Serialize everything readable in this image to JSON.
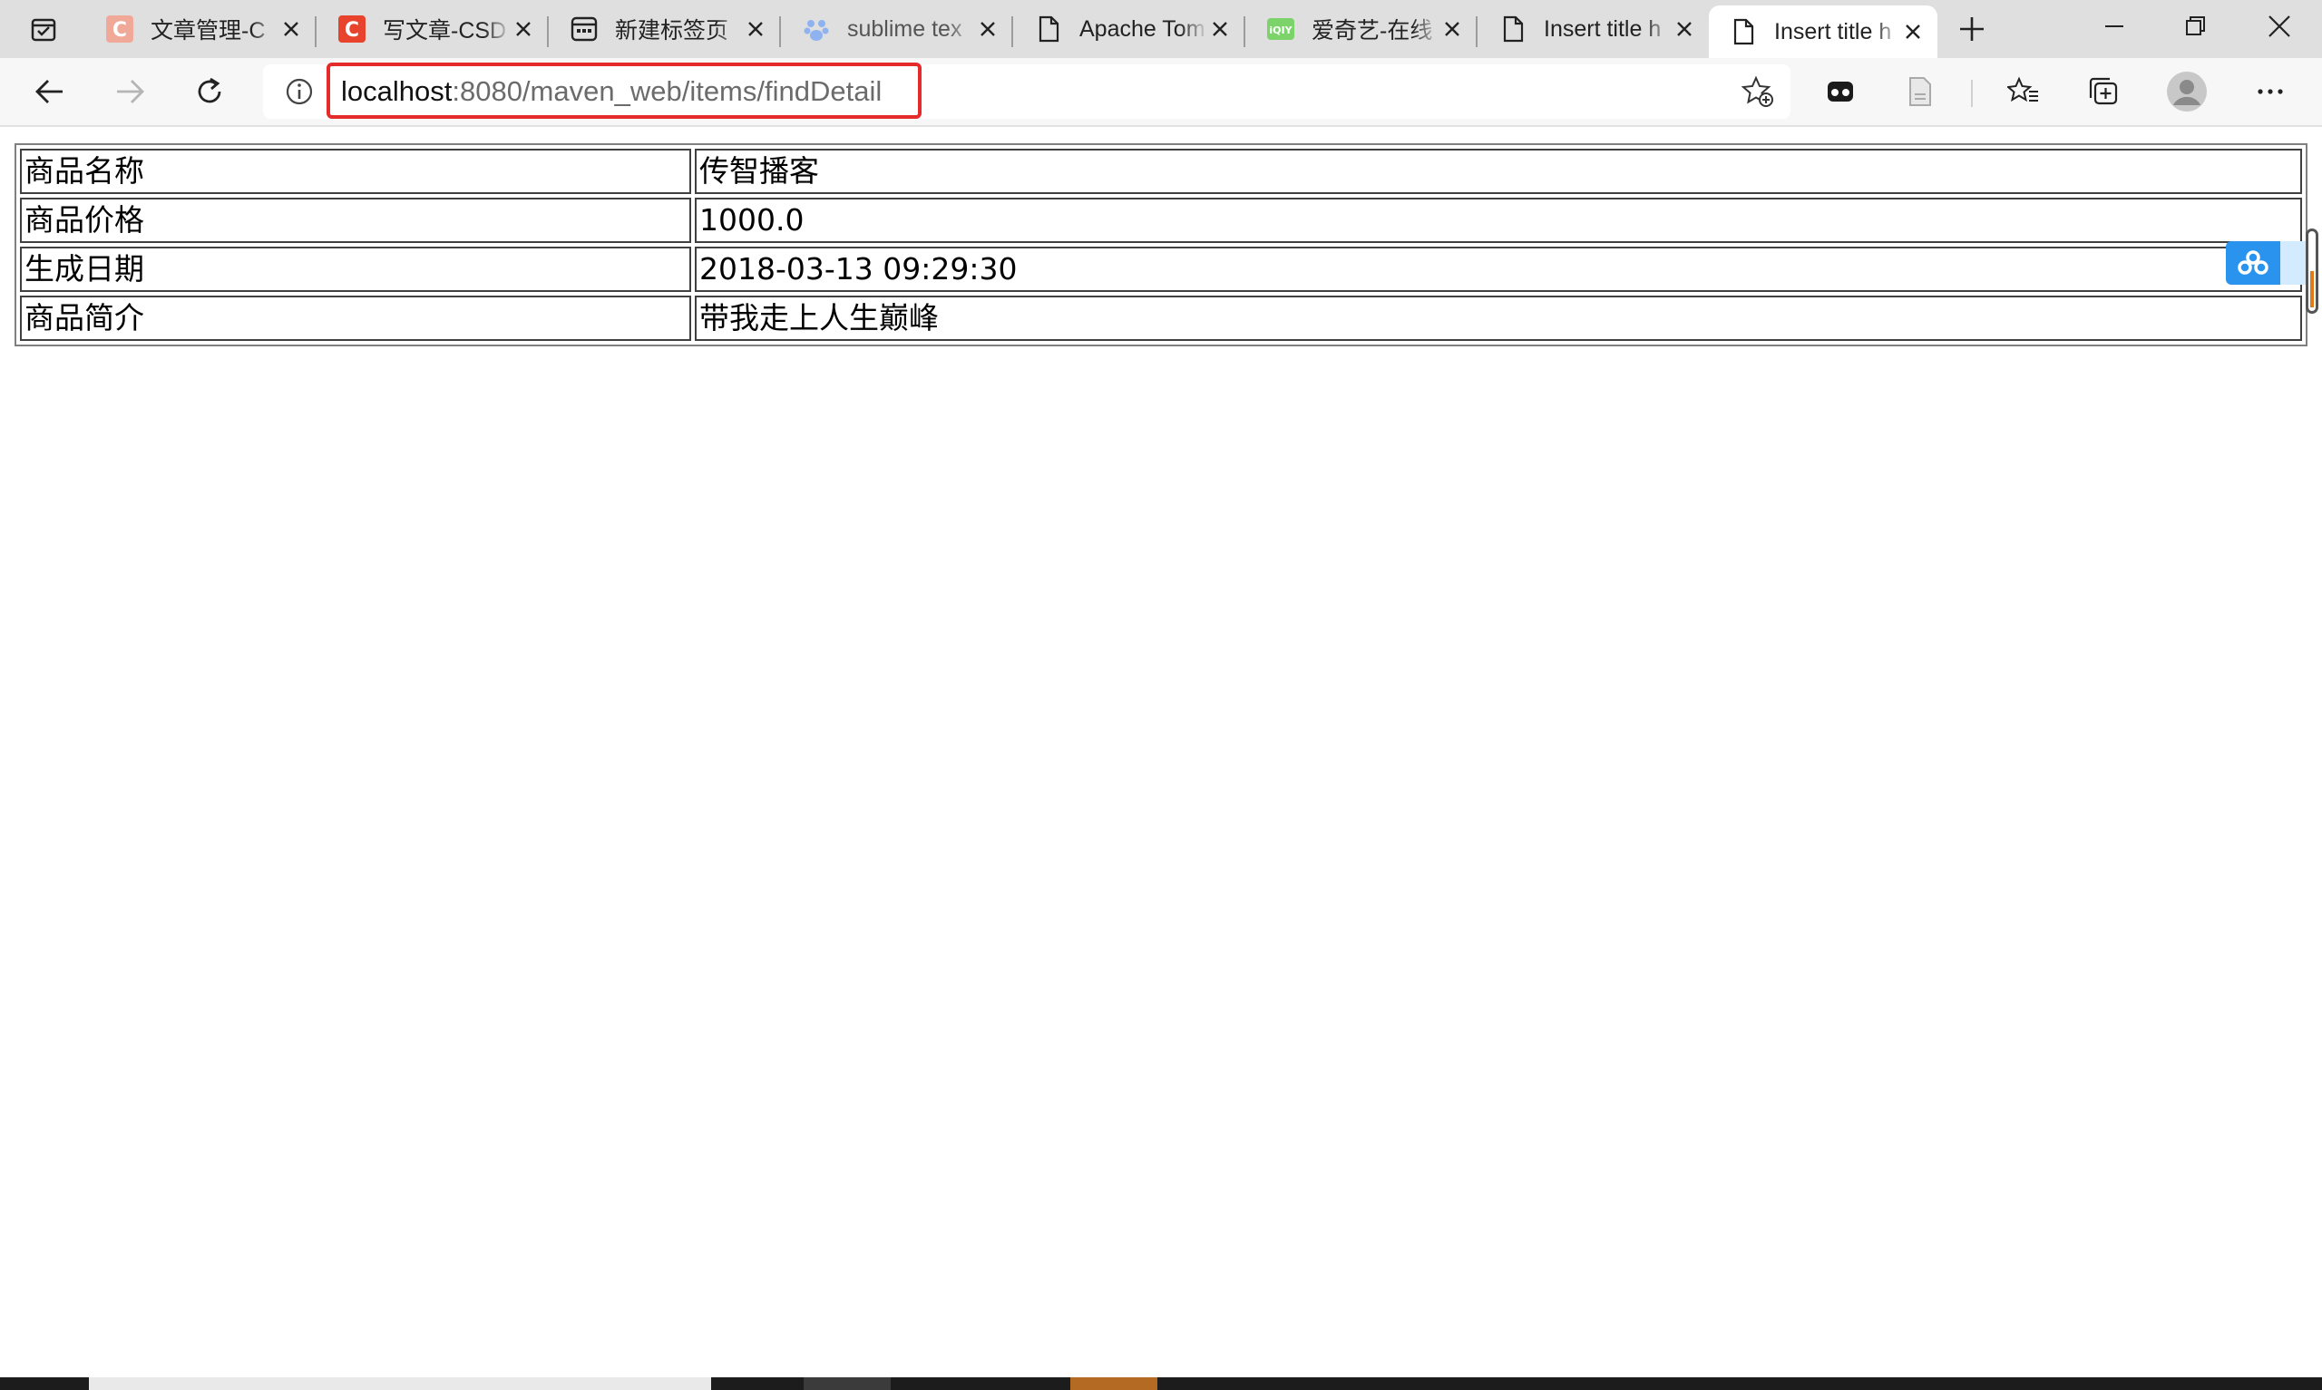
{
  "browser": {
    "tabs": [
      {
        "title": "文章管理-C",
        "favicon": "csdn-faded-icon",
        "active": false
      },
      {
        "title": "写文章-CSD",
        "favicon": "csdn-icon",
        "active": false
      },
      {
        "title": "新建标签页",
        "favicon": "newtab-page-icon",
        "active": false
      },
      {
        "title": "sublime tex",
        "favicon": "baidu-paw-icon",
        "active": false
      },
      {
        "title": "Apache Tom",
        "favicon": "document-icon",
        "active": false
      },
      {
        "title": "爱奇艺-在线",
        "favicon": "iqiyi-icon",
        "active": false
      },
      {
        "title": "Insert title h",
        "favicon": "document-icon",
        "active": false
      },
      {
        "title": "Insert title h",
        "favicon": "document-icon",
        "active": true
      }
    ],
    "url": {
      "host": "localhost",
      "path": ":8080/maven_web/items/findDetail"
    },
    "highlight_color": "#e52a2a"
  },
  "item_detail": {
    "rows": [
      {
        "label": "商品名称",
        "value": "传智播客"
      },
      {
        "label": "商品价格",
        "value": "1000.0"
      },
      {
        "label": "生成日期",
        "value": "2018-03-13 09:29:30"
      },
      {
        "label": "商品简介",
        "value": "带我走上人生巅峰"
      }
    ]
  },
  "colors": {
    "tab_strip": "#dfdfdf",
    "toolbar": "#f7f7f7",
    "cloud_widget": "#2a93ee"
  }
}
